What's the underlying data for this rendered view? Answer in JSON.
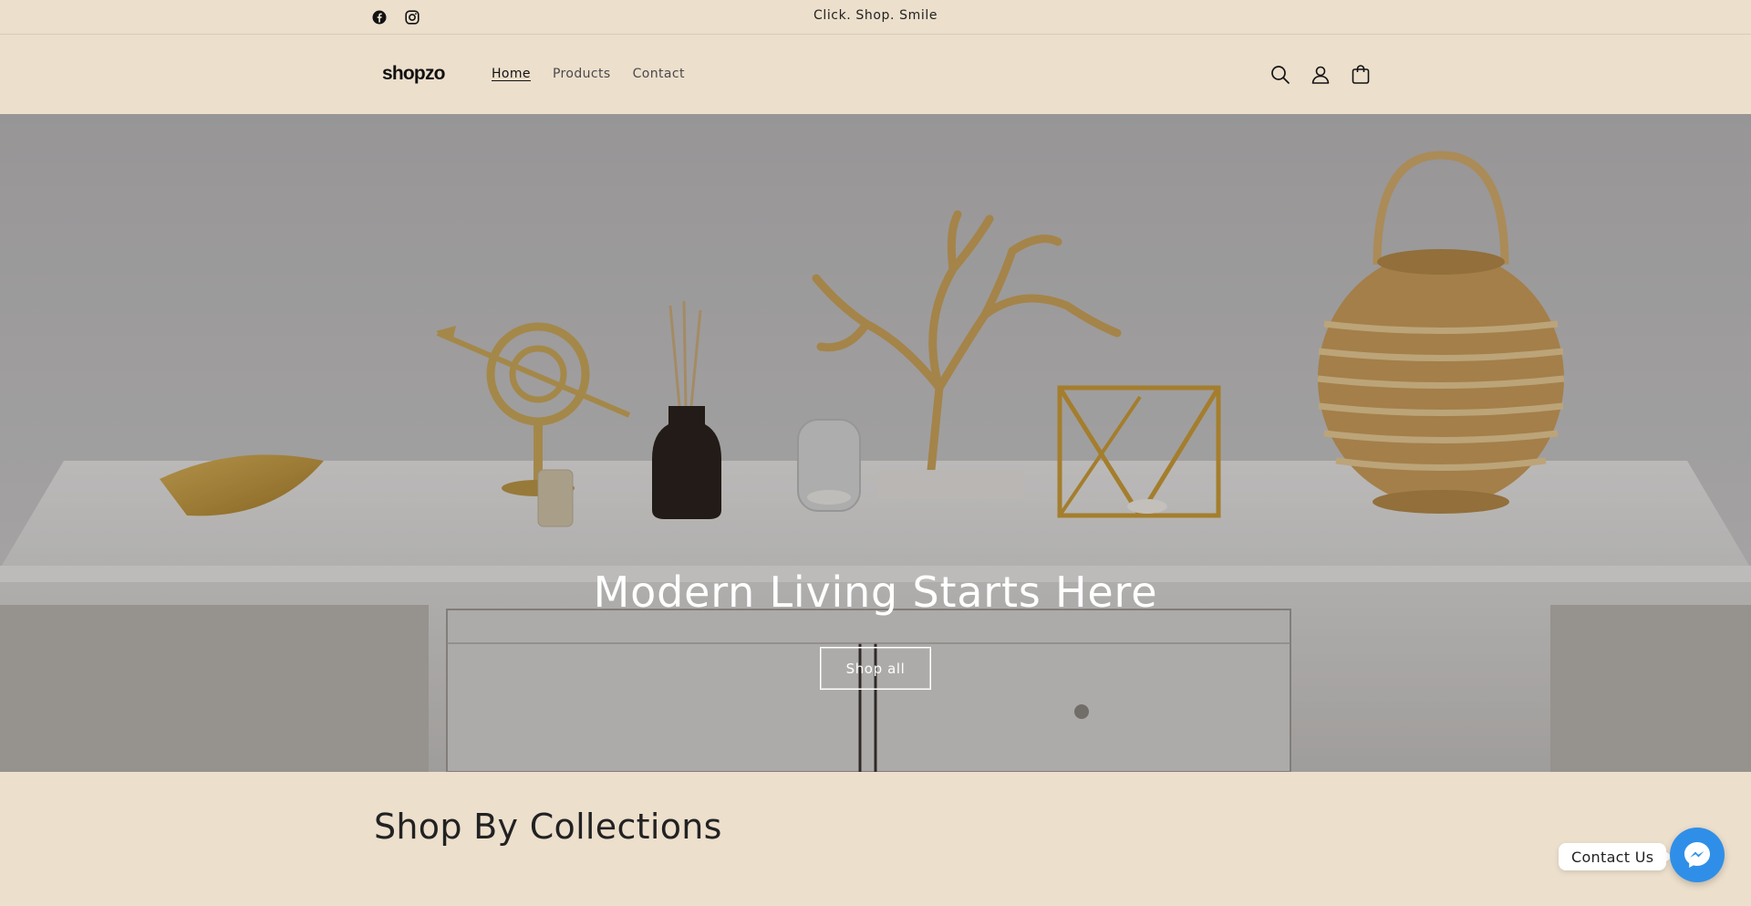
{
  "announcement": {
    "text": "Click. Shop. Smile"
  },
  "social": [
    {
      "icon": "facebook-icon"
    },
    {
      "icon": "instagram-icon"
    }
  ],
  "header": {
    "logo": "shopzo",
    "nav": [
      {
        "label": "Home",
        "active": true
      },
      {
        "label": "Products",
        "active": false
      },
      {
        "label": "Contact",
        "active": false
      }
    ],
    "icons": [
      "search-icon",
      "account-icon",
      "cart-icon"
    ]
  },
  "hero": {
    "title": "Modern Living Starts Here",
    "button_label": "Shop all"
  },
  "collections": {
    "title": "Shop By Collections"
  },
  "chat": {
    "label": "Contact Us",
    "icon": "messenger-icon"
  },
  "colors": {
    "background": "#ecdfcc",
    "text": "#121212",
    "chat_accent": "#2f8fe8"
  }
}
